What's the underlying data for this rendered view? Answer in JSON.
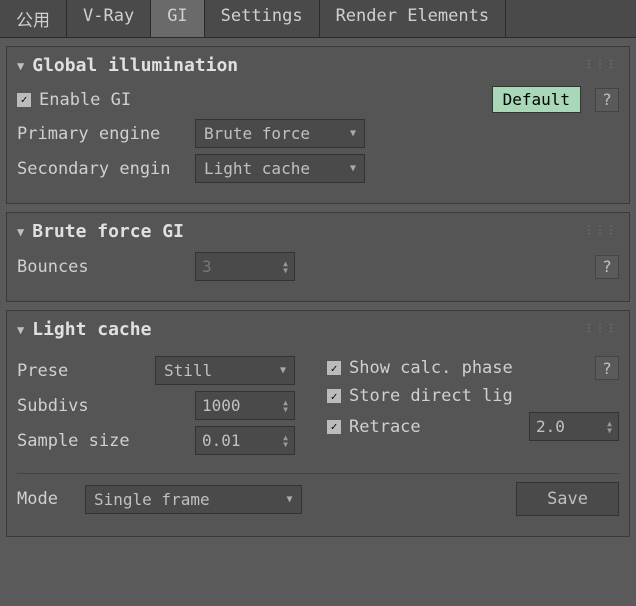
{
  "tabs": {
    "common": "公用",
    "vray": "V-Ray",
    "gi": "GI",
    "settings": "Settings",
    "render_elements": "Render Elements"
  },
  "gi_panel": {
    "title": "Global illumination",
    "enable_label": "Enable GI",
    "default_btn": "Default",
    "help": "?",
    "primary_engine_label": "Primary engine",
    "primary_engine_value": "Brute force",
    "secondary_engine_label": "Secondary engin",
    "secondary_engine_value": "Light cache"
  },
  "bf_panel": {
    "title": "Brute force GI",
    "bounces_label": "Bounces",
    "bounces_value": "3",
    "help": "?"
  },
  "lc_panel": {
    "title": "Light cache",
    "preset_label": "Prese",
    "preset_value": "Still",
    "subdivs_label": "Subdivs",
    "subdivs_value": "1000",
    "sample_size_label": "Sample size",
    "sample_size_value": "0.01",
    "show_calc_label": "Show calc. phase",
    "store_direct_label": "Store direct lig",
    "retrace_label": "Retrace",
    "retrace_value": "2.0",
    "help": "?",
    "mode_label": "Mode",
    "mode_value": "Single frame",
    "save_btn": "Save"
  }
}
